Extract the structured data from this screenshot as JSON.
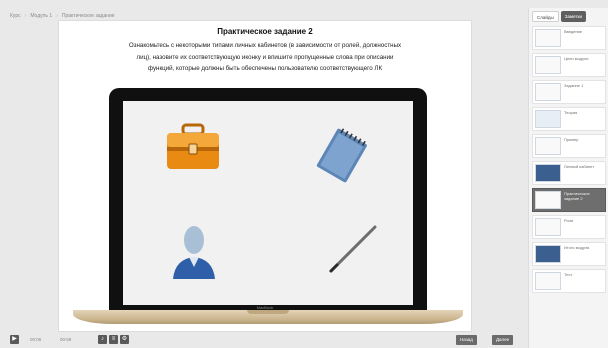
{
  "breadcrumb": [
    "Курс",
    "Модуль 1",
    "Практическое задание"
  ],
  "slide": {
    "title": "Практическое задание 2",
    "instruction_lines": [
      "Ознакомьтесь с некоторыми типами личных кабинетов (в зависимости от ролей, должностных",
      "лиц), назовите их соответствующую иконку и впишите пропущенные слова при описании",
      "функций, которые должны быть обеспечены пользователю соответствующего ЛК"
    ],
    "laptop_brand": "MacBook",
    "icons": [
      "briefcase-icon",
      "notepad-icon",
      "user-icon",
      "pen-icon"
    ]
  },
  "side_panel": {
    "tabs": [
      "Слайды",
      "Заметки"
    ],
    "thumbnails": [
      {
        "label": "Введение",
        "style": "light"
      },
      {
        "label": "Цели модуля",
        "style": "light"
      },
      {
        "label": "Задание 1",
        "style": "light"
      },
      {
        "label": "Теория",
        "style": "light"
      },
      {
        "label": "Пример",
        "style": "light"
      },
      {
        "label": "Личный кабинет",
        "style": "dark"
      },
      {
        "label": "Практическое задание 2",
        "style": "selected"
      },
      {
        "label": "Роли",
        "style": "light"
      },
      {
        "label": "Итоги модуля",
        "style": "dark"
      },
      {
        "label": "Тест",
        "style": "light"
      }
    ]
  },
  "bottom_bar": {
    "play_icon": "play-icon",
    "time_current": "00:06",
    "time_total": "00:59",
    "prev_label": "Назад",
    "next_label": "Далее"
  }
}
